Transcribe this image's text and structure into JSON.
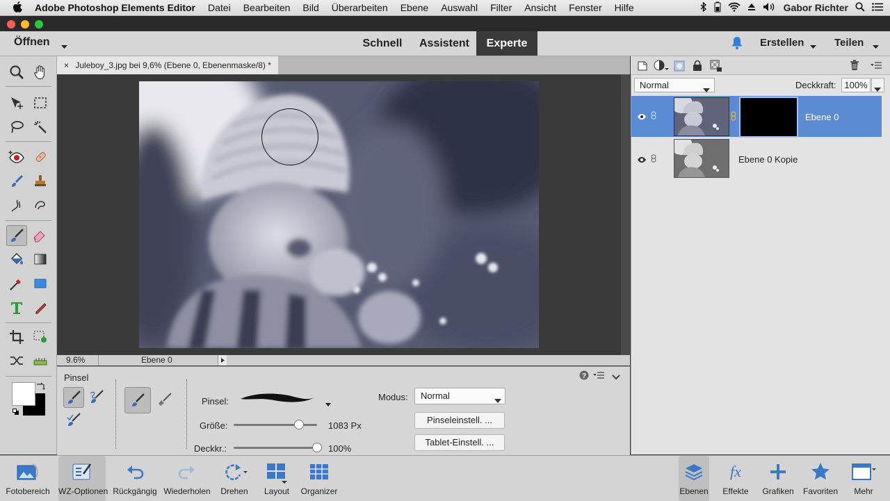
{
  "menubar": {
    "app_name": "Adobe Photoshop Elements Editor",
    "items": [
      "Datei",
      "Bearbeiten",
      "Bild",
      "Überarbeiten",
      "Ebene",
      "Auswahl",
      "Filter",
      "Ansicht",
      "Fenster",
      "Hilfe"
    ],
    "user": "Gabor Richter"
  },
  "header": {
    "open_label": "Öffnen",
    "tabs": [
      "Schnell",
      "Assistent",
      "Experte"
    ],
    "active_tab": "Experte",
    "create_label": "Erstellen",
    "share_label": "Teilen"
  },
  "document": {
    "tab_title": "Juleboy_3.jpg bei 9,6% (Ebene 0, Ebenenmaske/8) *",
    "close": "×",
    "zoom": "9.6%",
    "status_layer": "Ebene 0"
  },
  "options": {
    "tool_name": "Pinsel",
    "brush_label": "Pinsel:",
    "size_label": "Größe:",
    "size_value": "1083 Px",
    "size_fraction": 0.78,
    "opacity_label": "Deckkr.:",
    "opacity_value": "100%",
    "opacity_fraction": 1.0,
    "mode_label": "Modus:",
    "mode_value": "Normal",
    "brush_settings_btn": "Pinseleinstell. ...",
    "tablet_settings_btn": "Tablet-Einstell. ..."
  },
  "layers": {
    "blend_mode": "Normal",
    "opacity_label": "Deckkraft:",
    "opacity_value": "100%",
    "items": [
      {
        "name": "Ebene 0",
        "selected": true
      },
      {
        "name": "Ebene 0 Kopie",
        "selected": false
      }
    ]
  },
  "bottombar": {
    "left": [
      "Fotobereich",
      "WZ-Optionen",
      "Rückgängig",
      "Wiederholen",
      "Drehen",
      "Layout",
      "Organizer"
    ],
    "right": [
      "Ebenen",
      "Effekte",
      "Grafiken",
      "Favoriten",
      "Mehr"
    ]
  },
  "colors": {
    "accent": "#5b8bd2",
    "dark_bar": "#3a3a3a",
    "notification": "#2f7fe0"
  }
}
